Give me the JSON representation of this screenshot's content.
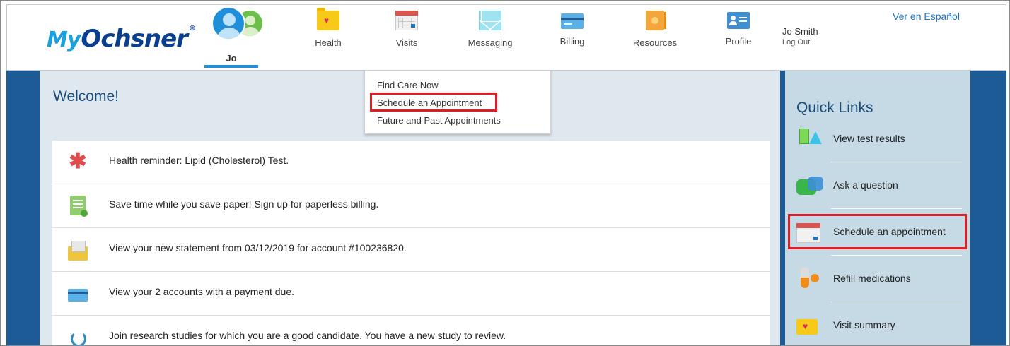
{
  "brand": {
    "logo_my": "My",
    "logo_name": "Ochsner",
    "logo_mark": "®"
  },
  "avatar": {
    "name": "Jo"
  },
  "nav": {
    "health": "Health",
    "visits": "Visits",
    "messaging": "Messaging",
    "billing": "Billing",
    "resources": "Resources",
    "profile": "Profile"
  },
  "user": {
    "name": "Jo Smith",
    "logout": "Log Out"
  },
  "language_link": "Ver en Español",
  "welcome": "Welcome!",
  "visits_menu": {
    "items": [
      "Find Care Now",
      "Schedule an Appointment",
      "Future and Past Appointments"
    ],
    "highlighted": "Schedule an Appointment"
  },
  "alerts": [
    {
      "icon": "medical-star-icon",
      "text": "Health reminder: Lipid (Cholesterol) Test."
    },
    {
      "icon": "paperless-bill-icon",
      "text": "Save time while you save paper! Sign up for paperless billing."
    },
    {
      "icon": "statement-envelope-icon",
      "text": "View your new statement from 03/12/2019 for account #100236820."
    },
    {
      "icon": "credit-card-icon",
      "text": "View your 2 accounts with a payment due."
    },
    {
      "icon": "microscope-icon",
      "text": "Join research studies for which you are a good candidate. You have a new study to review."
    }
  ],
  "quick_links": {
    "title": "Quick Links",
    "items": [
      {
        "icon": "test-tubes-icon",
        "label": "View test results"
      },
      {
        "icon": "chat-bubbles-icon",
        "label": "Ask a question"
      },
      {
        "icon": "calendar-icon",
        "label": "Schedule an appointment"
      },
      {
        "icon": "pills-icon",
        "label": "Refill medications"
      },
      {
        "icon": "folder-heart-icon",
        "label": "Visit summary"
      }
    ]
  },
  "colors": {
    "brand_blue": "#0a3f8f",
    "accent_blue": "#1e8fd8",
    "page_dark_blue": "#1c5b96",
    "highlight_red": "#e21c23"
  }
}
